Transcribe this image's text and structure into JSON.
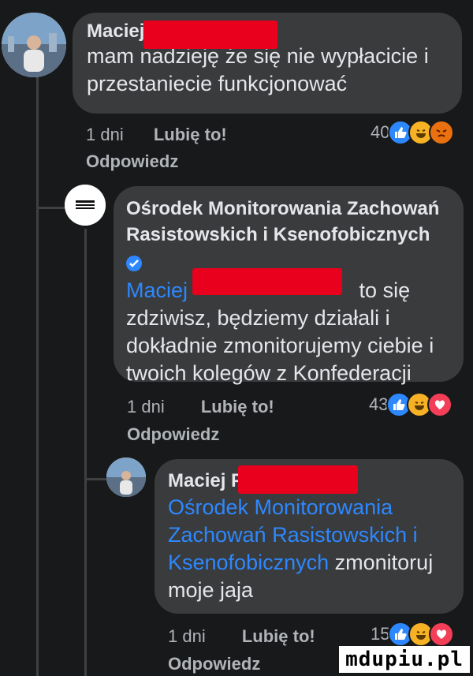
{
  "comment1": {
    "author": "Maciej",
    "text": "mam nadzieję że się nie wypłacicie i przestaniecie funkcjonować",
    "time": "1 dni",
    "like_label": "Lubię to!",
    "reply_label": "Odpowiedz",
    "reaction_count": "40",
    "reactions": [
      "like-icon",
      "haha-icon",
      "angry-icon"
    ]
  },
  "comment2": {
    "author": "Ośrodek Monitorowania Zachowań Rasistowskich i Ksenofobicznych",
    "mention": "Maciej",
    "text": "to się zdziwisz, będziemy działali i dokładnie zmonitorujemy ciebie i twoich kolegów z Konfederacji",
    "time": "1 dni",
    "like_label": "Lubię to!",
    "reply_label": "Odpowiedz",
    "reaction_count": "43",
    "reactions": [
      "like-icon",
      "haha-icon",
      "love-icon"
    ]
  },
  "comment3": {
    "author": "Maciej P",
    "mention": "Ośrodek Monitorowania Zachowań Rasistowskich i Ksenofobicznych",
    "text": "zmonitoruj moje jaja",
    "time": "1 dni",
    "like_label": "Lubię to!",
    "reply_label": "Odpowiedz",
    "reaction_count": "15",
    "reactions": [
      "like-icon",
      "haha-icon",
      "love-icon"
    ]
  },
  "watermark": "mdupiu.pl",
  "colors": {
    "background": "#18191a",
    "bubble": "#3a3b3c",
    "mention": "#2d88ff",
    "redaction": "#e8001c"
  }
}
